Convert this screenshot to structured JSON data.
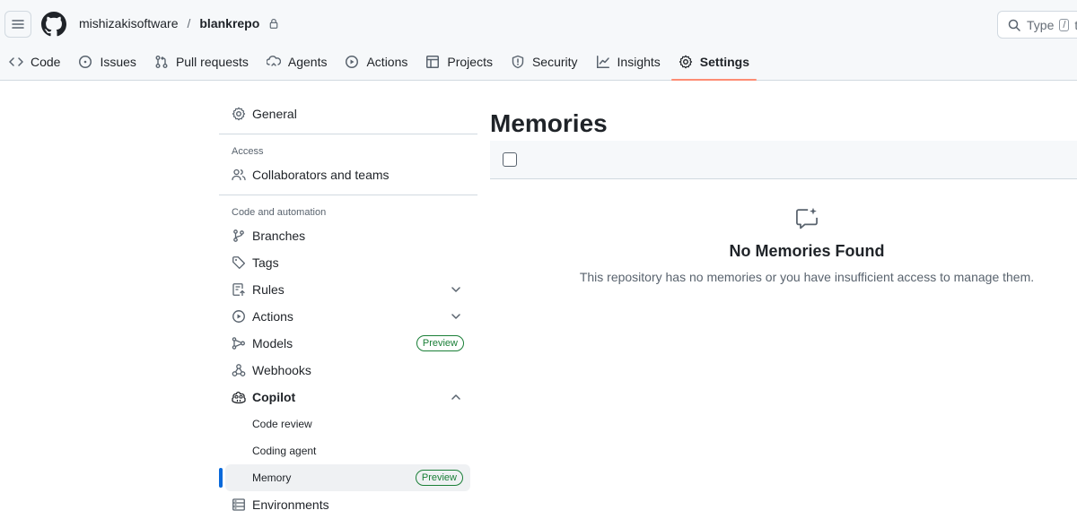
{
  "header": {
    "owner": "mishizakisoftware",
    "separator": "/",
    "repo": "blankrepo",
    "search_text": "Type",
    "search_kbd": "/",
    "search_suffix": "to"
  },
  "tabs": [
    {
      "label": "Code",
      "icon": "code-icon"
    },
    {
      "label": "Issues",
      "icon": "issue-opened-icon"
    },
    {
      "label": "Pull requests",
      "icon": "git-pull-request-icon"
    },
    {
      "label": "Agents",
      "icon": "agent-icon"
    },
    {
      "label": "Actions",
      "icon": "play-icon"
    },
    {
      "label": "Projects",
      "icon": "table-icon"
    },
    {
      "label": "Security",
      "icon": "shield-icon"
    },
    {
      "label": "Insights",
      "icon": "graph-icon"
    },
    {
      "label": "Settings",
      "icon": "gear-icon",
      "selected": true
    }
  ],
  "sidebar": {
    "general": "General",
    "access_label": "Access",
    "collaborators": "Collaborators and teams",
    "code_automation_label": "Code and automation",
    "branches": "Branches",
    "tags": "Tags",
    "rules": "Rules",
    "actions": "Actions",
    "models": "Models",
    "models_badge": "Preview",
    "webhooks": "Webhooks",
    "copilot": "Copilot",
    "code_review": "Code review",
    "coding_agent": "Coding agent",
    "memory": "Memory",
    "memory_badge": "Preview",
    "environments": "Environments"
  },
  "main": {
    "title": "Memories",
    "empty_title": "No Memories Found",
    "empty_description": "This repository has no memories or you have insufficient access to manage them."
  },
  "colors": {
    "accent_blue": "#0969da",
    "tab_underline": "#fd8c73",
    "preview_green": "#1a7f37"
  }
}
